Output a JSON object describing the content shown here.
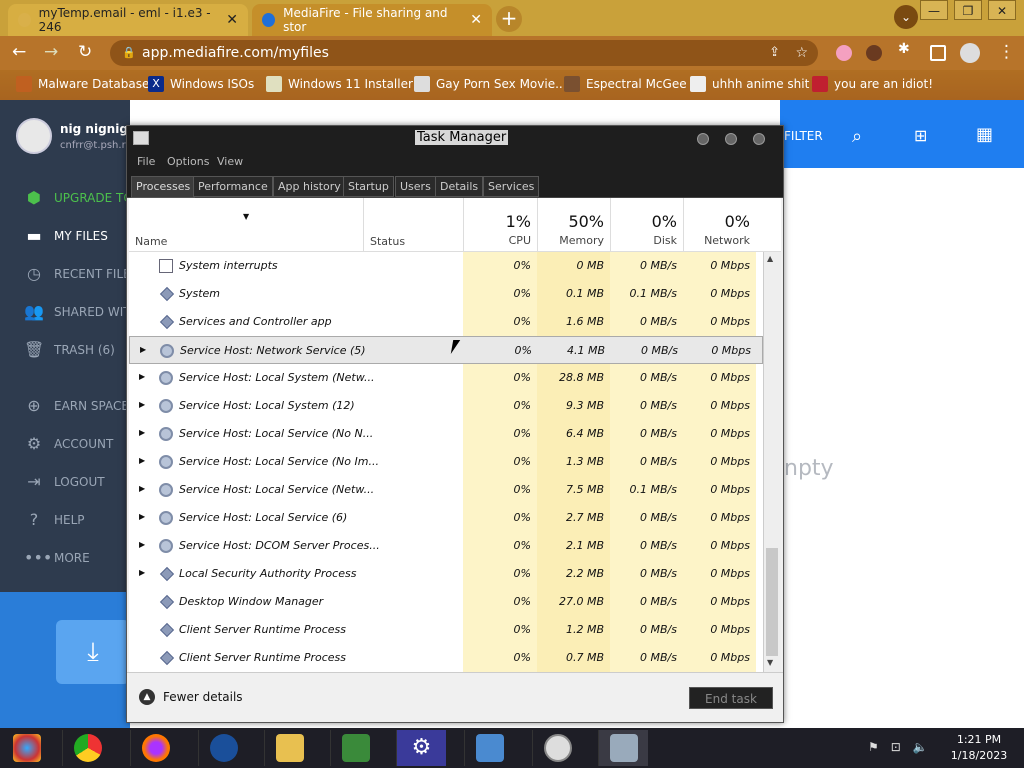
{
  "browser": {
    "tabs": [
      {
        "title": "myTemp.email - eml - i1.e3 - 246",
        "active": true
      },
      {
        "title": "MediaFire - File sharing and stor",
        "active": false
      }
    ],
    "url": "app.mediafire.com/myfiles",
    "bookmarks": [
      "Malware Database",
      "Windows ISOs",
      "Windows 11 Installer",
      "Gay Porn Sex Movie...",
      "Espectral McGee",
      "uhhh anime shit",
      "you are an idiot!"
    ]
  },
  "mediafire": {
    "user_name": "nig nignig",
    "user_email": "cnfrr@t.psh.r",
    "nav": [
      "UPGRADE TO",
      "MY FILES",
      "RECENT FILES",
      "SHARED WITH",
      "TRASH (6)",
      "EARN SPACE",
      "ACCOUNT",
      "LOGOUT",
      "HELP",
      "MORE"
    ],
    "filter_label": "FILTER",
    "empty_text": "npty"
  },
  "taskmgr": {
    "title": "Task Manager",
    "menu": [
      "File",
      "Options",
      "View"
    ],
    "tabs": [
      "Processes",
      "Performance",
      "App history",
      "Startup",
      "Users",
      "Details",
      "Services"
    ],
    "columns": {
      "name": "Name",
      "status": "Status",
      "cpu_pct": "1%",
      "cpu": "CPU",
      "mem_pct": "50%",
      "mem": "Memory",
      "disk_pct": "0%",
      "disk": "Disk",
      "net_pct": "0%",
      "net": "Network"
    },
    "rows": [
      {
        "name": "System interrupts",
        "cpu": "0%",
        "mem": "0 MB",
        "disk": "0 MB/s",
        "net": "0 Mbps"
      },
      {
        "name": "System",
        "cpu": "0%",
        "mem": "0.1 MB",
        "disk": "0.1 MB/s",
        "net": "0 Mbps"
      },
      {
        "name": "Services and Controller app",
        "cpu": "0%",
        "mem": "1.6 MB",
        "disk": "0 MB/s",
        "net": "0 Mbps"
      },
      {
        "name": "Service Host: Network Service (5)",
        "cpu": "0%",
        "mem": "4.1 MB",
        "disk": "0 MB/s",
        "net": "0 Mbps"
      },
      {
        "name": "Service Host: Local System (Netw...",
        "cpu": "0%",
        "mem": "28.8 MB",
        "disk": "0 MB/s",
        "net": "0 Mbps"
      },
      {
        "name": "Service Host: Local System (12)",
        "cpu": "0%",
        "mem": "9.3 MB",
        "disk": "0 MB/s",
        "net": "0 Mbps"
      },
      {
        "name": "Service Host: Local Service (No N...",
        "cpu": "0%",
        "mem": "6.4 MB",
        "disk": "0 MB/s",
        "net": "0 Mbps"
      },
      {
        "name": "Service Host: Local Service (No Im...",
        "cpu": "0%",
        "mem": "1.3 MB",
        "disk": "0 MB/s",
        "net": "0 Mbps"
      },
      {
        "name": "Service Host: Local Service (Netw...",
        "cpu": "0%",
        "mem": "7.5 MB",
        "disk": "0.1 MB/s",
        "net": "0 Mbps"
      },
      {
        "name": "Service Host: Local Service (6)",
        "cpu": "0%",
        "mem": "2.7 MB",
        "disk": "0 MB/s",
        "net": "0 Mbps"
      },
      {
        "name": "Service Host: DCOM Server Proces...",
        "cpu": "0%",
        "mem": "2.1 MB",
        "disk": "0 MB/s",
        "net": "0 Mbps"
      },
      {
        "name": "Local Security Authority Process",
        "cpu": "0%",
        "mem": "2.2 MB",
        "disk": "0 MB/s",
        "net": "0 Mbps"
      },
      {
        "name": "Desktop Window Manager",
        "cpu": "0%",
        "mem": "27.0 MB",
        "disk": "0 MB/s",
        "net": "0 Mbps"
      },
      {
        "name": "Client Server Runtime Process",
        "cpu": "0%",
        "mem": "1.2 MB",
        "disk": "0 MB/s",
        "net": "0 Mbps"
      },
      {
        "name": "Client Server Runtime Process",
        "cpu": "0%",
        "mem": "0.7 MB",
        "disk": "0 MB/s",
        "net": "0 Mbps"
      }
    ],
    "fewer_details": "Fewer details",
    "end_task": "End task"
  },
  "taskbar": {
    "time": "1:21 PM",
    "date": "1/18/2023"
  }
}
